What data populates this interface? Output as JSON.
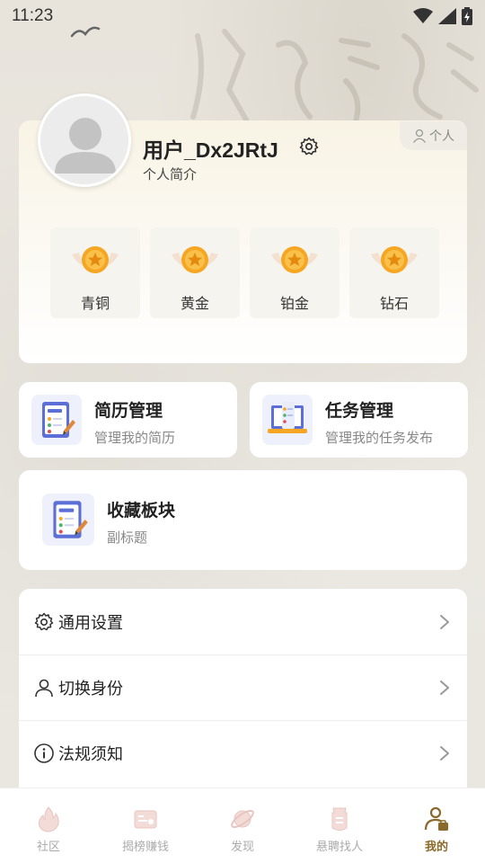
{
  "status_bar": {
    "time": "11:23"
  },
  "profile": {
    "username": "用户_Dx2JRtJ",
    "bio": "个人简介",
    "persona_tag": "个人"
  },
  "levels": [
    {
      "label": "青铜"
    },
    {
      "label": "黄金"
    },
    {
      "label": "铂金"
    },
    {
      "label": "钻石"
    }
  ],
  "tools": {
    "resume": {
      "title": "简历管理",
      "subtitle": "管理我的简历"
    },
    "task": {
      "title": "任务管理",
      "subtitle": "管理我的任务发布"
    }
  },
  "favorites": {
    "title": "收藏板块",
    "subtitle": "副标题"
  },
  "menu": [
    {
      "label": "通用设置",
      "icon": "gear-icon"
    },
    {
      "label": "切换身份",
      "icon": "user-icon"
    },
    {
      "label": "法规须知",
      "icon": "info-icon"
    }
  ],
  "nav": [
    {
      "label": "社区",
      "icon": "flame-icon",
      "active": false
    },
    {
      "label": "揭榜赚钱",
      "icon": "ticket-icon",
      "active": false
    },
    {
      "label": "发现",
      "icon": "planet-icon",
      "active": false
    },
    {
      "label": "悬聘找人",
      "icon": "scroll-icon",
      "active": false
    },
    {
      "label": "我的",
      "icon": "person-badge-icon",
      "active": true
    }
  ],
  "colors": {
    "accent": "#8a6a2a",
    "medal": "#f5a623"
  }
}
